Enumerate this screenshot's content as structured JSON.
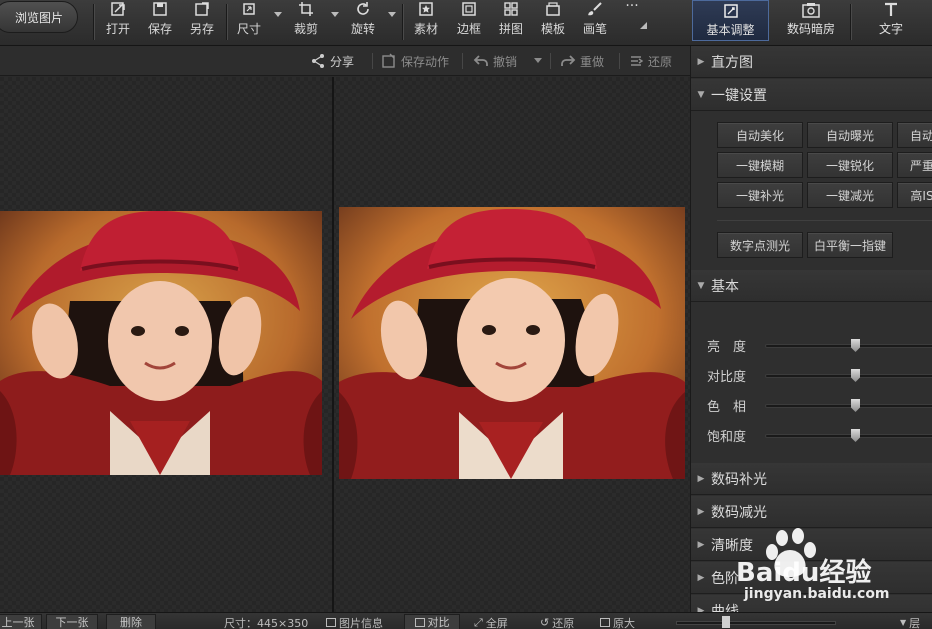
{
  "toolbar": {
    "browse": "浏览图片",
    "tools": [
      {
        "label": "打开",
        "icon": "open-icon"
      },
      {
        "label": "保存",
        "icon": "save-icon"
      },
      {
        "label": "另存",
        "icon": "save-as-icon"
      },
      {
        "label": "尺寸",
        "icon": "resize-icon"
      },
      {
        "label": "裁剪",
        "icon": "crop-icon"
      },
      {
        "label": "旋转",
        "icon": "rotate-icon"
      },
      {
        "label": "素材",
        "icon": "sticker-icon"
      },
      {
        "label": "边框",
        "icon": "frame-icon"
      },
      {
        "label": "拼图",
        "icon": "collage-icon"
      },
      {
        "label": "模板",
        "icon": "template-icon"
      },
      {
        "label": "画笔",
        "icon": "brush-icon"
      }
    ],
    "more": "···",
    "right_tabs": [
      {
        "label": "基本调整",
        "icon": "adjust-icon",
        "active": true
      },
      {
        "label": "数码暗房",
        "icon": "darkroom-icon",
        "active": false
      },
      {
        "label": "文字",
        "icon": "text-icon",
        "active": false
      }
    ]
  },
  "actionbar": {
    "share": "分享",
    "save_action": "保存动作",
    "undo": "撤销",
    "redo": "重做",
    "restore": "还原"
  },
  "panel": {
    "histogram": "直方图",
    "one_click": "一键设置",
    "buttons_row1": [
      "自动美化",
      "自动曝光",
      "自动"
    ],
    "buttons_row2": [
      "一键模糊",
      "一键锐化",
      "严重"
    ],
    "buttons_row3": [
      "一键补光",
      "一键减光",
      "高IS"
    ],
    "buttons_row4": [
      "数字点测光",
      "白平衡一指键"
    ],
    "basic": "基本",
    "sliders": [
      {
        "label": "亮　度",
        "value": 0.5
      },
      {
        "label": "对比度",
        "value": 0.5
      },
      {
        "label": "色　相",
        "value": 0.5
      },
      {
        "label": "饱和度",
        "value": 0.5
      }
    ],
    "sections": [
      "数码补光",
      "数码减光",
      "清晰度",
      "色阶",
      "曲线"
    ]
  },
  "bottombar": {
    "prev": "上一张",
    "next": "下一张",
    "delete": "删除",
    "size": "尺寸：445×350",
    "info": "图片信息",
    "compare": "对比",
    "fullscreen": "全屏",
    "actual": "还原",
    "original": "原大",
    "layout": "层"
  },
  "watermark": {
    "logo": "Baidu经验",
    "url": "jingyan.baidu.com"
  },
  "colors": {
    "accent": "#4d6a9c",
    "hat": "#b01b2c",
    "background": "#2a2a2a"
  }
}
